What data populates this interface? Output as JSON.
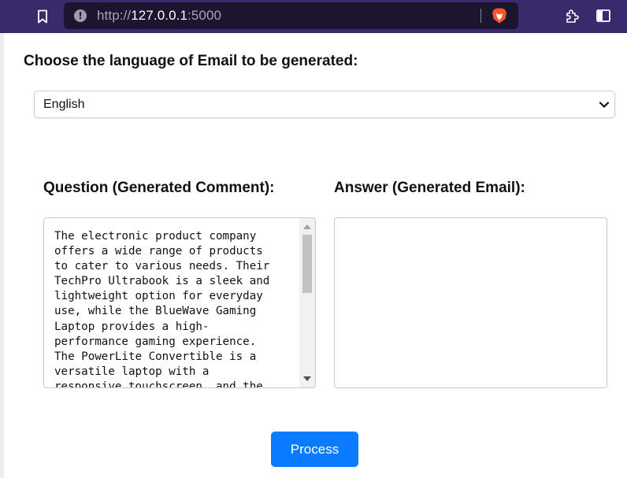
{
  "browser": {
    "url_scheme": "http://",
    "url_host": "127.0.0.1",
    "url_port": ":5000",
    "info_icon_glyph": "!",
    "icons": [
      "bookmark-icon",
      "info-icon",
      "brave-lion-icon",
      "extensions-icon",
      "sidebar-icon"
    ],
    "bar_color": "#3b2a6b"
  },
  "language": {
    "heading": "Choose the language of Email to be generated:",
    "selected": "English"
  },
  "question": {
    "heading": "Question (Generated Comment):",
    "text": "The electronic product company\noffers a wide range of products\nto cater to various needs. Their\nTechPro Ultrabook is a sleek and\nlightweight option for everyday\nuse, while the BlueWave Gaming\nLaptop provides a high-\nperformance gaming experience.\nThe PowerLite Convertible is a\nversatile laptop with a\nresponsive touchscreen, and the"
  },
  "answer": {
    "heading": "Answer (Generated Email):",
    "text": ""
  },
  "actions": {
    "process_label": "Process",
    "accent_color": "#0a7cff"
  }
}
